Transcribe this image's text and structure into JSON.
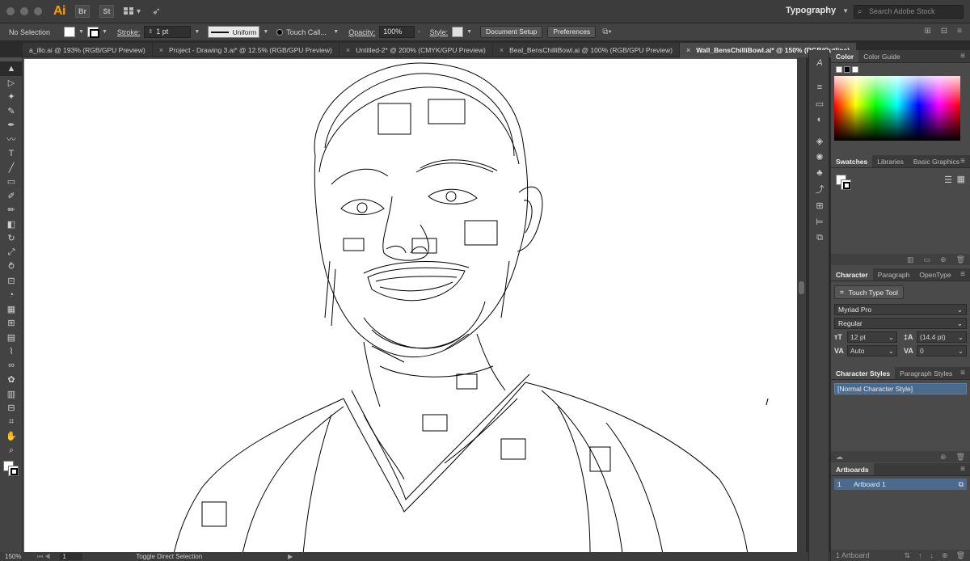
{
  "app": {
    "logo": "Ai",
    "bridge_icon": "Br",
    "stock_icon": "St",
    "workspace": "Typography",
    "stock_search_placeholder": "Search Adobe Stock"
  },
  "control_bar": {
    "selection": "No Selection",
    "stroke_label": "Stroke:",
    "stroke_weight": "1 pt",
    "profile": "Uniform",
    "brush": "Touch Call...",
    "opacity_label": "Opacity:",
    "opacity": "100%",
    "style_label": "Style:",
    "document_setup": "Document Setup",
    "preferences": "Preferences"
  },
  "tabs": [
    {
      "label": "a_illo.ai @ 193% (RGB/GPU Preview)",
      "active": false
    },
    {
      "label": "Project - Drawing 3.ai* @ 12.5% (RGB/GPU Preview)",
      "active": false
    },
    {
      "label": "Untitled-2* @ 200% (CMYK/GPU Preview)",
      "active": false
    },
    {
      "label": "Beal_BensChilliBowl.ai @ 100% (RGB/GPU Preview)",
      "active": false
    },
    {
      "label": "Wall_BensChilliBowl.ai* @ 150% (RGB/Outline)",
      "active": true
    }
  ],
  "status": {
    "zoom": "150%",
    "artboard_num": "1",
    "message": "Toggle Direct Selection"
  },
  "color_panel": {
    "tabs": [
      "Color",
      "Color Guide"
    ]
  },
  "swatches_panel": {
    "tabs": [
      "Swatches",
      "Libraries",
      "Basic Graphics"
    ]
  },
  "character_panel": {
    "tabs": [
      "Character",
      "Paragraph",
      "OpenType"
    ],
    "touch_type_tool": "Touch Type Tool",
    "font_family": "Myriad Pro",
    "font_style": "Regular",
    "font_size": "12 pt",
    "leading": "(14.4 pt)",
    "kerning": "Auto",
    "tracking": "0"
  },
  "character_styles_panel": {
    "tabs": [
      "Character Styles",
      "Paragraph Styles"
    ],
    "items": [
      "[Normal Character Style]"
    ]
  },
  "artboards_panel": {
    "tabs": [
      "Artboards"
    ],
    "items": [
      {
        "num": "1",
        "name": "Artboard 1"
      }
    ],
    "footer": "1 Artboard"
  },
  "colors": {
    "accent_orange": "#ff9a00",
    "selection_blue": "#4c6a8c"
  },
  "icons": {
    "tools": [
      "selection-tool-icon",
      "direct-selection-tool-icon",
      "magic-wand-icon",
      "lasso-icon",
      "pen-tool-icon",
      "curvature-tool-icon",
      "type-tool-icon",
      "line-tool-icon",
      "rectangle-tool-icon",
      "paintbrush-icon",
      "pencil-icon",
      "eraser-icon",
      "rotate-icon",
      "scale-icon",
      "warp-icon",
      "free-transform-icon",
      "shape-builder-icon",
      "perspective-grid-icon",
      "mesh-icon",
      "gradient-icon",
      "eyedropper-icon",
      "blend-icon",
      "symbol-sprayer-icon",
      "column-graph-icon",
      "artboard-tool-icon",
      "slice-icon",
      "hand-tool-icon",
      "zoom-tool-icon"
    ]
  }
}
